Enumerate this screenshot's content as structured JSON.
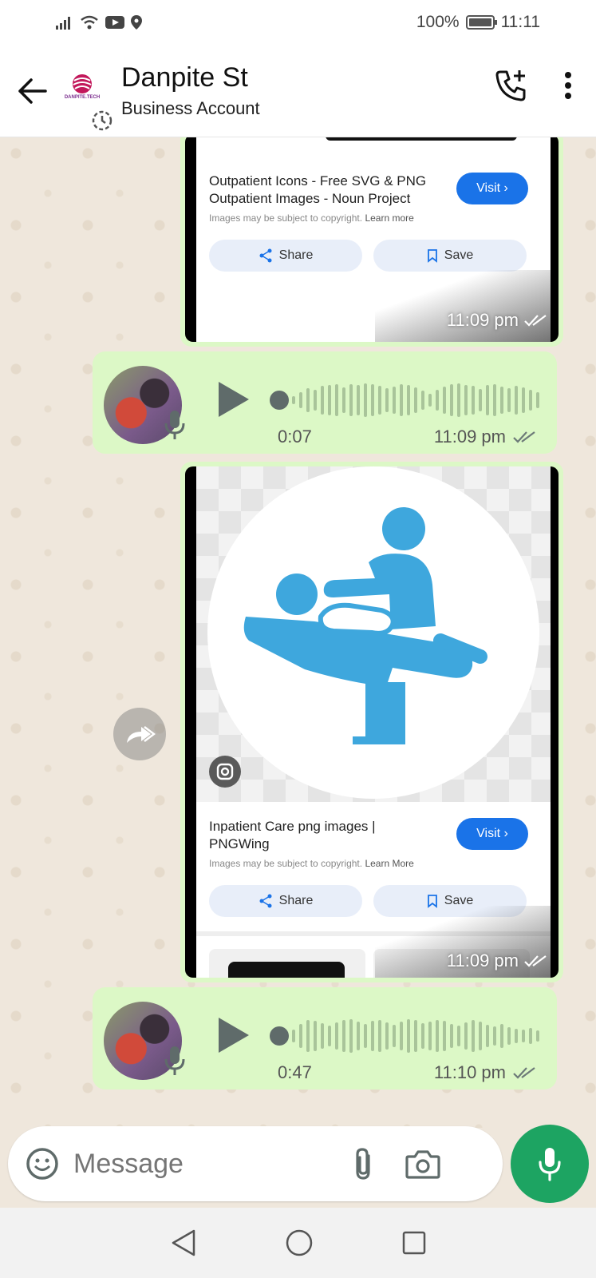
{
  "status_bar": {
    "battery": "100%",
    "time": "11:11"
  },
  "header": {
    "contact_name": "Danpite St",
    "subtitle": "Business Account",
    "logo_text": "DANPITE.TECH"
  },
  "messages": {
    "card1": {
      "title_line1": "Outpatient Icons - Free SVG & PNG",
      "title_line2": "Outpatient Images - Noun Project",
      "note": "Images may be subject to copyright.",
      "learn_more": "Learn more",
      "visit": "Visit ›",
      "share": "Share",
      "save": "Save",
      "time": "11:09 pm"
    },
    "voice1": {
      "duration": "0:07",
      "time": "11:09 pm"
    },
    "card2": {
      "title_line1": "Inpatient Care png images |",
      "title_line2": "PNGWing",
      "note": "Images may be subject to copyright.",
      "learn_more": "Learn More",
      "visit": "Visit ›",
      "share": "Share",
      "save": "Save",
      "time": "11:09 pm"
    },
    "voice2": {
      "duration": "0:47",
      "time": "11:10 pm"
    }
  },
  "input": {
    "placeholder": "Message"
  },
  "colors": {
    "bubble": "#dcf8c6",
    "accent": "#1da462",
    "visit_button": "#1a73e8",
    "illustration": "#3ea7dd"
  },
  "icons": [
    "back-arrow-icon",
    "add-call-icon",
    "more-vert-icon",
    "play-icon",
    "mic-icon",
    "forward-icon",
    "emoji-icon",
    "attach-icon",
    "camera-icon",
    "nav-back-icon",
    "nav-home-icon",
    "nav-recents-icon"
  ]
}
